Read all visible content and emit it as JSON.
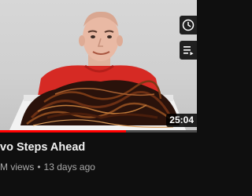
{
  "video": {
    "duration": "25:04",
    "progress_fraction": 0.64,
    "title": "vo Steps Ahead",
    "views": "M views",
    "separator": "•",
    "published": "13 days ago"
  },
  "hover_actions": {
    "watch_later_icon": "clock-icon",
    "add_to_queue_icon": "queue-icon"
  },
  "colors": {
    "page_bg": "#0f0f0f",
    "progress": "#ff0000",
    "shirt": "#d62a24",
    "title": "#f1f1f1",
    "meta": "#aaaaaa"
  }
}
